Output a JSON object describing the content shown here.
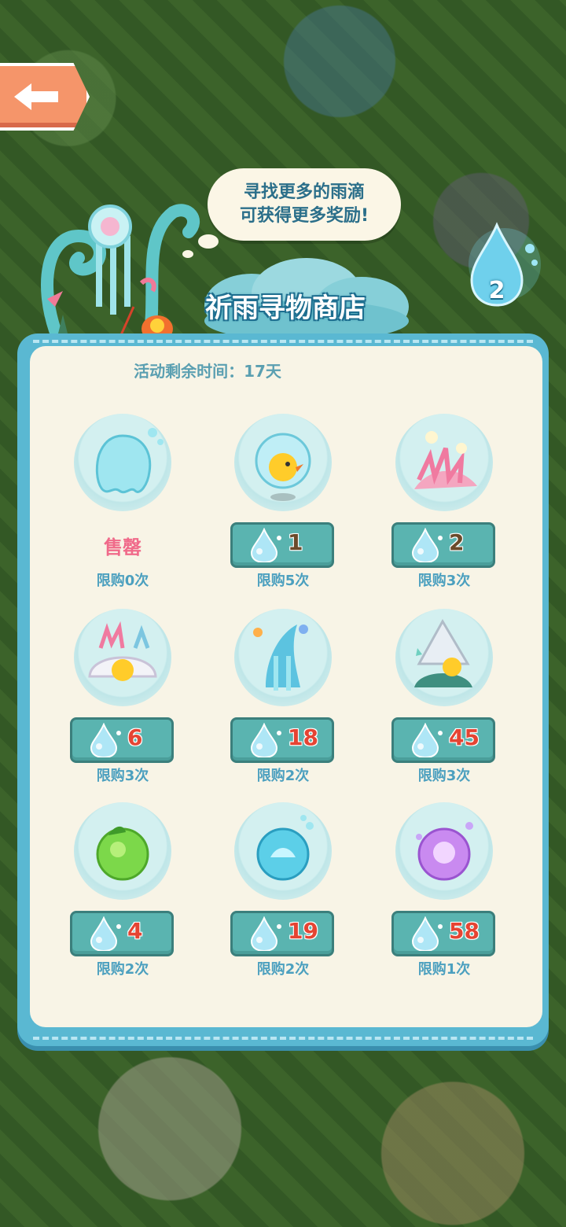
{
  "bubble": {
    "line1": "寻找更多的雨滴",
    "line2": "可获得更多奖励!"
  },
  "currency": {
    "count": "2",
    "icon": "raindrop-icon"
  },
  "title": "祈雨寻物商店",
  "timer": "活动剩余时间：17天",
  "colors": {
    "panel": "#5ab8d2",
    "panel_inner": "#f8f4e6",
    "button": "#5ab4b0",
    "sold": "#f06a8a",
    "limit": "#4ca0bf"
  },
  "items": [
    {
      "icon": "water-spirit-icon",
      "sold_label": "售罄",
      "limit": "限购0次"
    },
    {
      "icon": "chick-bubble-icon",
      "price": "1",
      "price_color": "#6b4a2a",
      "limit": "限购5次"
    },
    {
      "icon": "pink-coral-icon",
      "price": "2",
      "price_color": "#6b4a2a",
      "limit": "限购3次"
    },
    {
      "icon": "pearl-shell-icon",
      "price": "6",
      "price_color": "#e54433",
      "limit": "限购3次"
    },
    {
      "icon": "water-fountain-icon",
      "price": "18",
      "price_color": "#e54433",
      "limit": "限购2次"
    },
    {
      "icon": "conch-shell-icon",
      "price": "45",
      "price_color": "#e54433",
      "limit": "限购3次"
    },
    {
      "icon": "green-orb-icon",
      "price": "4",
      "price_color": "#e54433",
      "limit": "限购2次"
    },
    {
      "icon": "blue-orb-icon",
      "price": "19",
      "price_color": "#e54433",
      "limit": "限购2次"
    },
    {
      "icon": "purple-orb-icon",
      "price": "58",
      "price_color": "#e54433",
      "limit": "限购1次"
    }
  ]
}
